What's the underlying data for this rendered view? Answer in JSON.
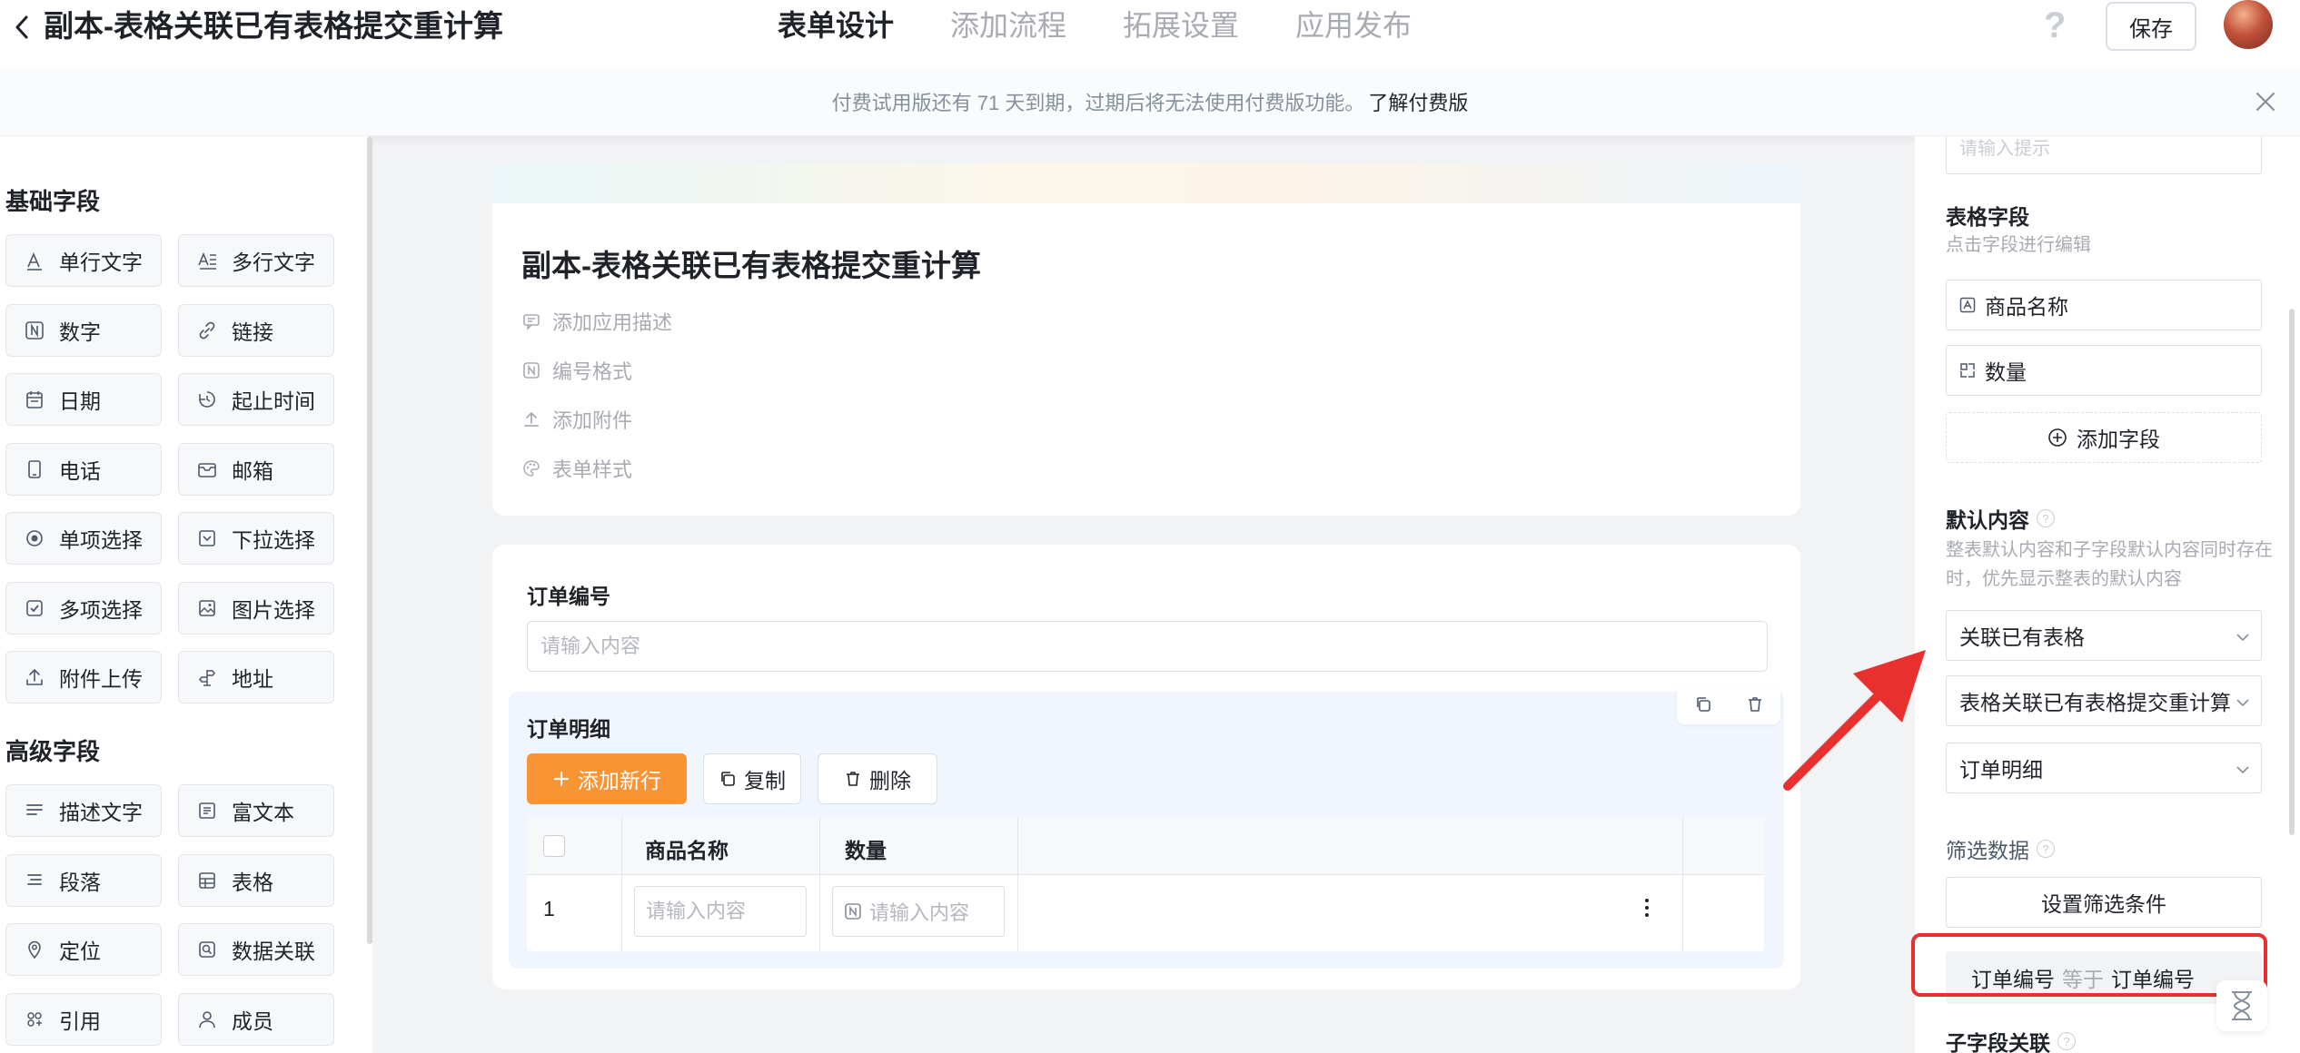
{
  "header": {
    "title": "副本-表格关联已有表格提交重计算",
    "tabs": [
      {
        "label": "表单设计",
        "active": true
      },
      {
        "label": "添加流程",
        "active": false
      },
      {
        "label": "拓展设置",
        "active": false
      },
      {
        "label": "应用发布",
        "active": false
      }
    ],
    "help": "?",
    "save_label": "保存"
  },
  "notice": {
    "text": "付费试用版还有 71 天到期，过期后将无法使用付费版功能。",
    "link": "了解付费版"
  },
  "left_panel": {
    "basic_title": "基础字段",
    "basic_fields": [
      {
        "label": "单行文字",
        "icon": "single-line-text-icon"
      },
      {
        "label": "多行文字",
        "icon": "multi-line-text-icon"
      },
      {
        "label": "数字",
        "icon": "number-icon"
      },
      {
        "label": "链接",
        "icon": "link-icon"
      },
      {
        "label": "日期",
        "icon": "calendar-icon"
      },
      {
        "label": "起止时间",
        "icon": "time-range-icon"
      },
      {
        "label": "电话",
        "icon": "phone-icon"
      },
      {
        "label": "邮箱",
        "icon": "mail-icon"
      },
      {
        "label": "单项选择",
        "icon": "radio-icon"
      },
      {
        "label": "下拉选择",
        "icon": "dropdown-icon"
      },
      {
        "label": "多项选择",
        "icon": "checkbox-icon"
      },
      {
        "label": "图片选择",
        "icon": "image-icon"
      },
      {
        "label": "附件上传",
        "icon": "upload-icon"
      },
      {
        "label": "地址",
        "icon": "address-icon"
      }
    ],
    "advanced_title": "高级字段",
    "advanced_fields": [
      {
        "label": "描述文字",
        "icon": "description-icon"
      },
      {
        "label": "富文本",
        "icon": "rich-text-icon"
      },
      {
        "label": "段落",
        "icon": "paragraph-icon"
      },
      {
        "label": "表格",
        "icon": "table-icon"
      },
      {
        "label": "定位",
        "icon": "location-icon"
      },
      {
        "label": "数据关联",
        "icon": "data-link-icon"
      },
      {
        "label": "引用",
        "icon": "reference-icon"
      },
      {
        "label": "成员",
        "icon": "member-icon"
      }
    ]
  },
  "form": {
    "title": "副本-表格关联已有表格提交重计算",
    "meta": [
      {
        "label": "添加应用描述",
        "icon": "comment-icon"
      },
      {
        "label": "编号格式",
        "icon": "number-format-icon"
      },
      {
        "label": "添加附件",
        "icon": "upload-icon"
      },
      {
        "label": "表单样式",
        "icon": "palette-icon"
      }
    ],
    "order_no": {
      "label": "订单编号",
      "placeholder": "请输入内容"
    },
    "detail": {
      "title": "订单明细",
      "add_row": "添加新行",
      "copy": "复制",
      "delete": "删除",
      "columns": [
        "商品名称",
        "数量"
      ],
      "rows": [
        {
          "index": "1",
          "name_placeholder": "请输入内容",
          "qty_placeholder": "请输入内容"
        }
      ]
    }
  },
  "right_panel": {
    "top_placeholder": "请输入提示",
    "table_fields_title": "表格字段",
    "table_fields_hint": "点击字段进行编辑",
    "table_fields": [
      {
        "label": "商品名称",
        "icon": "text-field-icon"
      },
      {
        "label": "数量",
        "icon": "number-field-icon"
      }
    ],
    "add_field": "添加字段",
    "default_title": "默认内容",
    "default_hint": "整表默认内容和子字段默认内容同时存在时，优先显示整表的默认内容",
    "selects": [
      "关联已有表格",
      "表格关联已有表格提交重计算",
      "订单明细"
    ],
    "filter_title": "筛选数据",
    "filter_button": "设置筛选条件",
    "filter_condition": {
      "left": "订单编号",
      "op": "等于",
      "right": "订单编号"
    },
    "subfield_title": "子字段关联"
  },
  "colors": {
    "accent": "#f99434",
    "annotation": "#e8302e"
  }
}
